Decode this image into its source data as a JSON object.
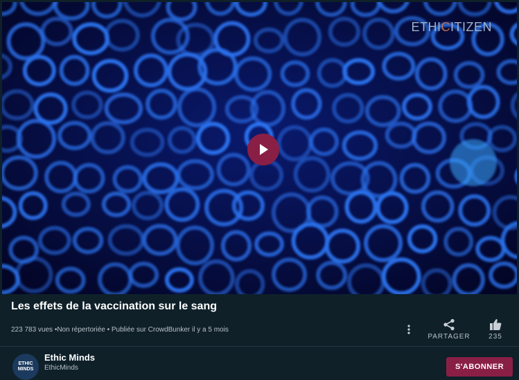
{
  "player": {
    "watermark_prefix": "ETHI",
    "watermark_c": "C",
    "watermark_suffix": "ITIZEN",
    "accent_color": "#8a1f45"
  },
  "video": {
    "title": "Les effets de la vaccination sur le sang",
    "meta": "223 783 vues •Non répertoriée • Publiée sur CrowdBunker il y a 5 mois"
  },
  "actions": {
    "share_label": "PARTAGER",
    "like_count": "235"
  },
  "channel": {
    "name": "Ethic Minds",
    "handle": "EthicMinds",
    "avatar_text": "ETHIC MINDS",
    "subscribe_label": "S'ABONNER"
  },
  "icons": [
    "play-icon",
    "kebab-icon",
    "share-icon",
    "thumbs-up-icon"
  ]
}
